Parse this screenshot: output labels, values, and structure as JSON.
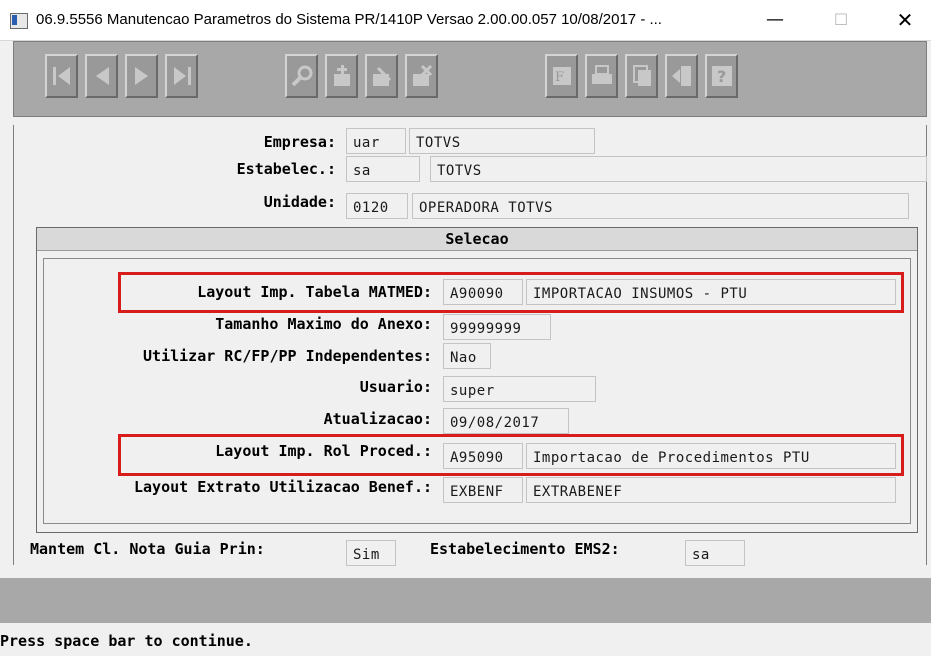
{
  "window": {
    "title": "06.9.5556 Manutencao  Parametros do Sistema PR/1410P Versao 2.00.00.057 10/08/2017 - ...",
    "minimize": "—",
    "maximize": "☐",
    "close": "✕"
  },
  "toolbar": {
    "buttons": [
      "first-record",
      "previous-record",
      "next-record",
      "last-record",
      "search",
      "add",
      "edit",
      "delete",
      "filter",
      "print",
      "copy",
      "exit",
      "help"
    ]
  },
  "header": {
    "empresa_label": "Empresa:",
    "empresa_code": "uar",
    "empresa_name": "TOTVS",
    "estab_label": "Estabelec.:",
    "estab_code": "sa",
    "estab_name": "TOTVS",
    "unidade_label": "Unidade:",
    "unidade_code": "0120",
    "unidade_name": "OPERADORA TOTVS"
  },
  "dialog": {
    "title": "Selecao",
    "rows": {
      "layout_matmed_label": "Layout Imp. Tabela MATMED:",
      "layout_matmed_code": "A90090",
      "layout_matmed_desc": "IMPORTACAO INSUMOS - PTU",
      "tamanho_label": "Tamanho Maximo do Anexo:",
      "tamanho_value": "99999999",
      "utilizar_label": "Utilizar RC/FP/PP Independentes:",
      "utilizar_value": "Nao",
      "usuario_label": "Usuario:",
      "usuario_value": "super",
      "atualizacao_label": "Atualizacao:",
      "atualizacao_value": "09/08/2017",
      "layout_rol_label": "Layout Imp. Rol Proced.:",
      "layout_rol_code": "A95090",
      "layout_rol_desc": "Importacao de Procedimentos PTU",
      "layout_extrato_label": "Layout Extrato Utilizacao Benef.:",
      "layout_extrato_code": "EXBENF",
      "layout_extrato_desc": "EXTRABENEF"
    }
  },
  "footer_fields": {
    "mantem_label": "Mantem Cl. Nota Guia Prin:",
    "mantem_value": "Sim",
    "estab_ems2_label": "Estabelecimento EMS2:",
    "estab_ems2_value": "sa"
  },
  "status": {
    "message": "Press space bar to continue."
  },
  "colors": {
    "highlight": "#d81c1c",
    "toolbar_bg": "#a8a8a8",
    "window_bg": "#f0f0f0"
  }
}
